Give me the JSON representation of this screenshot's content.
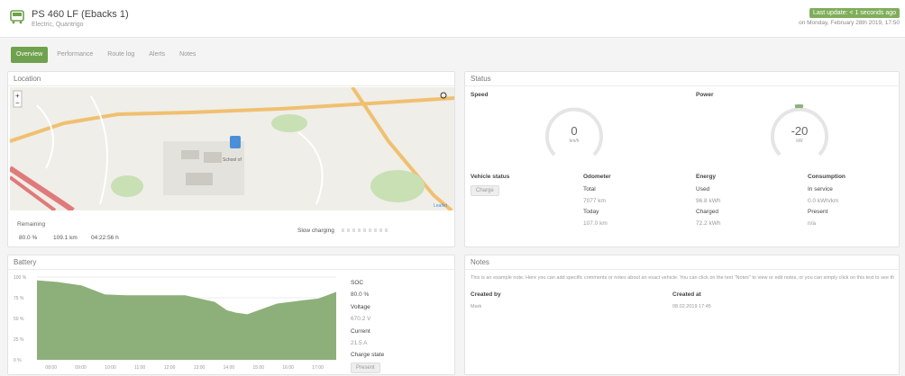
{
  "vehicle": {
    "title": "PS 460 LF (Ebacks 1)",
    "subtitle": "Electric, Quantrigo"
  },
  "header": {
    "badge": "Last update: < 1 seconds ago",
    "updated": "on Monday, February 28th 2019, 17:50"
  },
  "tabs": [
    {
      "label": "Overview"
    },
    {
      "label": "Performance"
    },
    {
      "label": "Route log"
    },
    {
      "label": "Alerts"
    },
    {
      "label": "Notes"
    }
  ],
  "location": {
    "title": "Location",
    "remaining_label": "Remaining",
    "remaining": [
      "80.0 %",
      "109.1 km",
      "04:22:56 h"
    ],
    "slow_charging": "Slow charging",
    "map_labels": {
      "place": "School of",
      "attribution": "Leaflet"
    }
  },
  "status": {
    "title": "Status",
    "speed_label": "Speed",
    "speed_value": "0",
    "speed_unit": "km/h",
    "power_label": "Power",
    "power_value": "-20",
    "power_unit": "kW",
    "vehicle_status_label": "Vehicle status",
    "vehicle_status": "Charge",
    "odometer": {
      "label": "Odometer",
      "total_label": "Total",
      "total": "7077 km",
      "today_label": "Today",
      "today": "107.0 km"
    },
    "energy": {
      "label": "Energy",
      "used_label": "Used",
      "used": "96.8 kWh",
      "charged_label": "Charged",
      "charged": "72.2 kWh"
    },
    "consumption": {
      "label": "Consumption",
      "inservice_label": "In service",
      "inservice": "0.0 kWh/km",
      "present_label": "Present",
      "present": "n/a"
    }
  },
  "battery": {
    "title": "Battery",
    "soc_label": "SOC",
    "soc": "80.0 %",
    "voltage_label": "Voltage",
    "voltage": "670.2 V",
    "current_label": "Current",
    "current": "21.5 A",
    "charge_state_label": "Charge state",
    "charge_state": "Present"
  },
  "notes": {
    "title": "Notes",
    "text": "This is an example note. Here you can add specific comments or notes about an exact vehicle. You can click on the text \"Notes\" to view or edit notes, or you can simply click on this text to see the full list.",
    "created_by_label": "Created by",
    "created_by": "Mark",
    "created_at_label": "Created at",
    "created_at": "08.02.2019 17:45"
  },
  "chart_data": {
    "type": "area",
    "title": "",
    "xlabel": "",
    "ylabel": "",
    "x": [
      "08:00",
      "09:00",
      "10:00",
      "11:00",
      "12:00",
      "13:00",
      "14:00",
      "15:00",
      "16:00",
      "17:00"
    ],
    "y_ticks": [
      "100 %",
      "75 %",
      "50 %",
      "25 %",
      "0 %"
    ],
    "ylim": [
      0,
      100
    ],
    "series": [
      {
        "values": [
          96,
          94,
          90,
          79,
          78,
          78,
          78,
          70,
          60,
          57,
          55,
          68,
          72,
          74,
          82
        ]
      }
    ],
    "xs": [
      7.5,
      8.2,
      9,
      9.8,
      10.5,
      11.5,
      12.5,
      13.5,
      13.9,
      14.2,
      14.6,
      15.6,
      16.5,
      17,
      17.6
    ],
    "xlim": [
      7.5,
      17.6
    ],
    "color": "#8db07a"
  }
}
